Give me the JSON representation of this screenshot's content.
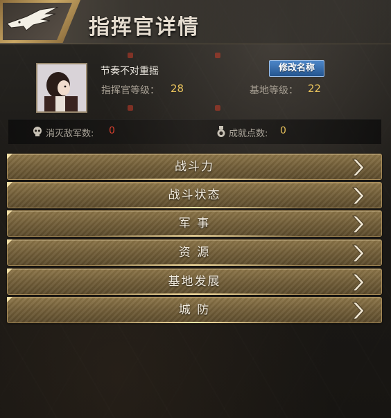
{
  "header": {
    "title": "指挥官详情",
    "logo_icon": "eagle-icon"
  },
  "profile": {
    "name": "节奏不对重摇",
    "rename_label": "修改名称",
    "commander_level_label": "指挥官等级：",
    "commander_level_value": "28",
    "base_level_label": "基地等级：",
    "base_level_value": "22"
  },
  "stats": {
    "kills_label": "消灭敌军数:",
    "kills_value": "0",
    "kills_icon": "skull-icon",
    "achievement_label": "成就点数:",
    "achievement_value": "0",
    "achievement_icon": "medal-icon"
  },
  "menu": {
    "items": [
      {
        "label": "战斗力"
      },
      {
        "label": "战斗状态"
      },
      {
        "label": "军 事"
      },
      {
        "label": "资 源"
      },
      {
        "label": "基地发展"
      },
      {
        "label": "城 防"
      }
    ]
  },
  "colors": {
    "gold_value": "#e8c25c",
    "red_value": "#d8402e",
    "rename_button": "#2f6bb0",
    "menu_gold": "#7c6640"
  }
}
